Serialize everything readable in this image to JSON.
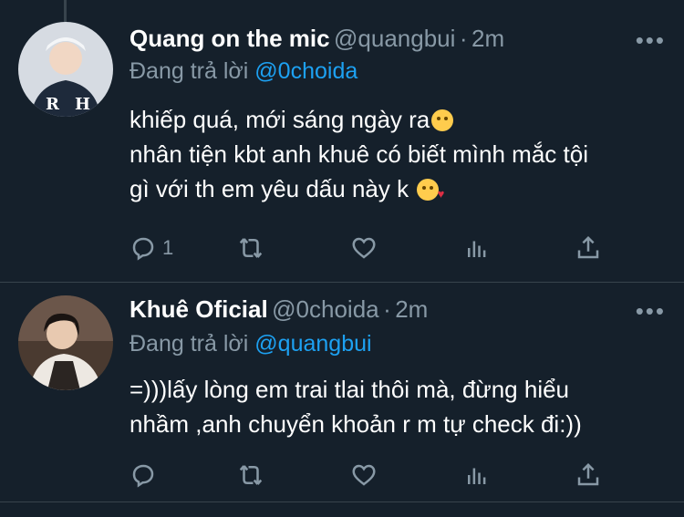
{
  "tweets": [
    {
      "name": "Quang on the mic",
      "handle": "@quangbui",
      "separator": "·",
      "time": "2m",
      "more": "•••",
      "replying_label": "Đang trả lời",
      "replying_to": "@0choida",
      "lines": [
        "khiếp quá, mới sáng ngày ra",
        "nhân tiện kbt anh khuê có biết mình mắc tội",
        "gì với th em yêu dấu này k "
      ],
      "reply_count": "1",
      "avatar_colors": [
        "#e0e3e8",
        "#1f2b3d"
      ]
    },
    {
      "name": "Khuê Oficial",
      "handle": "@0choida",
      "separator": "·",
      "time": "2m",
      "more": "•••",
      "replying_label": "Đang trả lời",
      "replying_to": "@quangbui",
      "lines": [
        "=)))lấy lòng em trai tlai thôi mà, đừng hiểu",
        "nhầm ,anh chuyển khoản r m tự check đi:))"
      ],
      "reply_count": "",
      "avatar_colors": [
        "#3a2f2a",
        "#e9e4df"
      ]
    }
  ]
}
